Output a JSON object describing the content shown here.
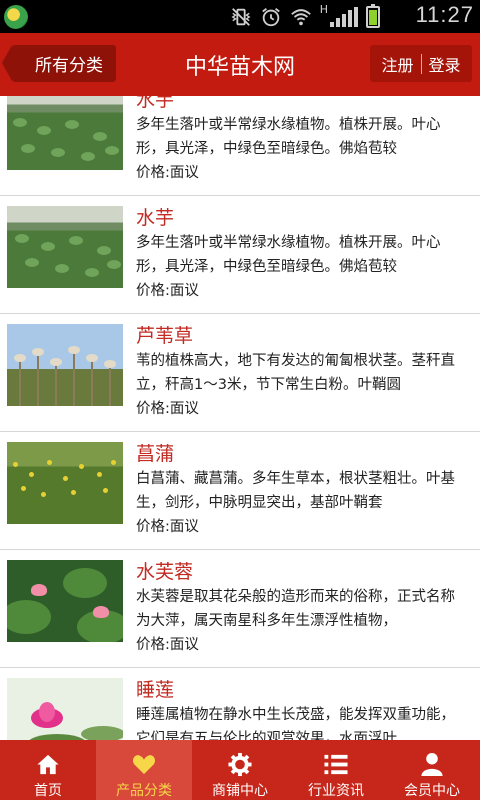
{
  "status_bar": {
    "network": "H",
    "time": "11:27",
    "colors": {
      "battery": "#8fd12c"
    }
  },
  "header": {
    "back_label": "所有分类",
    "title": "中华苗木网",
    "register_label": "注册",
    "login_label": "登录",
    "colors": {
      "bar": "#c31b0f",
      "button": "#8f1209"
    }
  },
  "list": {
    "items": [
      {
        "name": "水芋",
        "description": "多年生落叶或半常绿水缘植物。植株开展。叶心形，具光泽，中绿色至暗绿色。佛焰苞较",
        "price": "价格:面议",
        "thumb": "field-icon"
      },
      {
        "name": "水芋",
        "description": "多年生落叶或半常绿水缘植物。植株开展。叶心形，具光泽，中绿色至暗绿色。佛焰苞较",
        "price": "价格:面议",
        "thumb": "field-icon"
      },
      {
        "name": "芦苇草",
        "description": "苇的植株高大，地下有发达的匍匐根状茎。茎秆直立，秆高1～3米，节下常生白粉。叶鞘圆",
        "price": "价格:面议",
        "thumb": "reed-icon"
      },
      {
        "name": "菖蒲",
        "description": "白菖蒲、藏菖蒲。多年生草本，根状茎粗壮。叶基生，剑形，中脉明显突出，基部叶鞘套",
        "price": "价格:面议",
        "thumb": "iris-icon"
      },
      {
        "name": "水芙蓉",
        "description": "水芙蓉是取其花朵般的造形而来的俗称，正式名称为大萍，属天南星科多年生漂浮性植物，",
        "price": "价格:面议",
        "thumb": "lotus-pad-icon"
      },
      {
        "name": "睡莲",
        "description": "睡莲属植物在静水中生长茂盛，能发挥双重功能，它们是有五与伦比的观赏效果，水面浮叶",
        "price": "",
        "thumb": "water-lily-icon"
      }
    ],
    "colors": {
      "name": "#c22a22",
      "divider": "#d6d6d6"
    }
  },
  "bottom_nav": {
    "items": [
      {
        "label": "首页",
        "icon": "home-icon"
      },
      {
        "label": "产品分类",
        "icon": "heart-icon"
      },
      {
        "label": "商铺中心",
        "icon": "gear-icon"
      },
      {
        "label": "行业资讯",
        "icon": "list-icon"
      },
      {
        "label": "会员中心",
        "icon": "user-icon"
      }
    ],
    "active": "产品分类",
    "colors": {
      "bar": "#c7261a",
      "active_bg": "#d8483b",
      "active_text": "#f7d64a"
    }
  }
}
